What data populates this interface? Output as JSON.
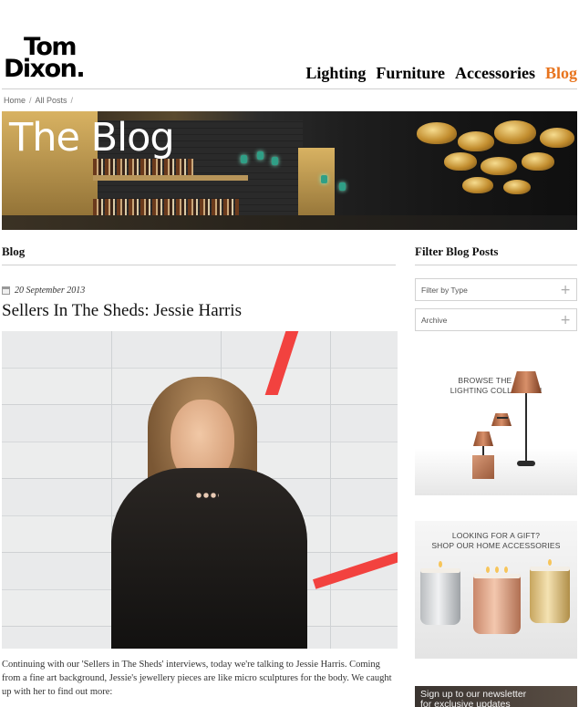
{
  "brand": {
    "line1": "Tom",
    "line2": "Dixon."
  },
  "nav": [
    {
      "label": "Lighting",
      "active": false
    },
    {
      "label": "Furniture",
      "active": false
    },
    {
      "label": "Accessories",
      "active": false
    },
    {
      "label": "Blog",
      "active": true
    }
  ],
  "colors": {
    "accent": "#e8741e",
    "rule": "#cfcfcf"
  },
  "breadcrumb": {
    "items": [
      "Home",
      "All Posts"
    ],
    "separator": "/"
  },
  "hero": {
    "title": "The Blog"
  },
  "main": {
    "section_title": "Blog",
    "post": {
      "date": "20 September 2013",
      "title": "Sellers In The Sheds: Jessie Harris",
      "excerpt": "Continuing with our 'Sellers in The Sheds' interviews, today we're talking to Jessie Harris. Coming from a fine art background, Jessie's jewellery pieces are like micro sculptures for the body. We caught up with her to find out more:"
    }
  },
  "sidebar": {
    "title": "Filter Blog Posts",
    "filters": [
      {
        "label": "Filter by Type",
        "icon": "plus-icon"
      },
      {
        "label": "Archive",
        "icon": "plus-icon"
      }
    ],
    "promo_lighting": {
      "line1": "BROWSE THE FULL",
      "line2": "LIGHTING COLLECTION"
    },
    "promo_gift": {
      "line1": "LOOKING FOR A GIFT?",
      "line2": "SHOP OUR HOME ACCESSORIES"
    },
    "newsletter": {
      "line1": "Sign up to our newsletter",
      "line2": "for exclusive updates"
    }
  }
}
